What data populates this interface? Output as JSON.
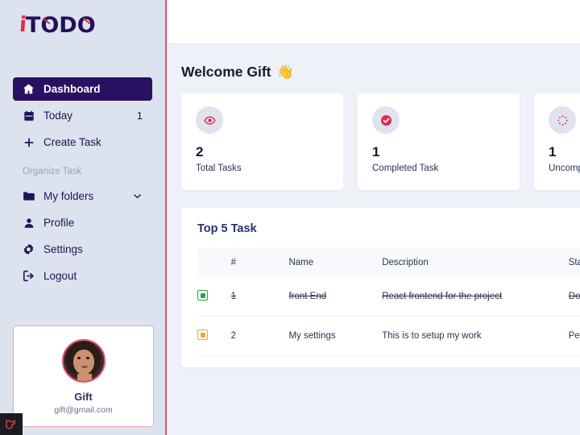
{
  "brand": {
    "logo_prefix": "i",
    "logo_text": "TODO",
    "accent_red": "#e8264a",
    "brand_navy": "#231257",
    "active_nav_bg": "#2a1060"
  },
  "sidebar": {
    "items": [
      {
        "id": "dashboard",
        "label": "Dashboard",
        "icon": "home-icon",
        "active": true,
        "badge": ""
      },
      {
        "id": "today",
        "label": "Today",
        "icon": "calendar-icon",
        "active": false,
        "badge": "1"
      },
      {
        "id": "create-task",
        "label": "Create Task",
        "icon": "plus-icon",
        "active": false,
        "badge": ""
      }
    ],
    "section_label": "Organize Task",
    "items2": [
      {
        "id": "my-folders",
        "label": "My folders",
        "icon": "folder-icon",
        "chevron": "chevron-down-icon"
      },
      {
        "id": "profile",
        "label": "Profile",
        "icon": "user-icon",
        "chevron": ""
      },
      {
        "id": "settings",
        "label": "Settings",
        "icon": "gear-icon",
        "chevron": ""
      },
      {
        "id": "logout",
        "label": "Logout",
        "icon": "logout-icon",
        "chevron": ""
      }
    ],
    "profile_card": {
      "avatar": "user-photo",
      "name": "Gift",
      "email": "gift@gmail.com"
    }
  },
  "debug_badge": {
    "icon": "laravel-logo-icon"
  },
  "main": {
    "welcome_title": "Welcome Gift",
    "welcome_emoji": "👋",
    "stats": [
      {
        "id": "total",
        "icon": "eye-icon",
        "value": "2",
        "label": "Total Tasks"
      },
      {
        "id": "completed",
        "icon": "check-circle-icon",
        "value": "1",
        "label": "Completed Task"
      },
      {
        "id": "uncompleted",
        "icon": "dotted-circle-icon",
        "value": "1",
        "label": "Uncompleted Task"
      }
    ],
    "panel": {
      "title": "Top 5 Task",
      "columns": [
        "#",
        "Name",
        "Description",
        "Status"
      ],
      "rows": [
        {
          "checkbox_color": "green",
          "index": "1",
          "name": "front End",
          "description": "React frontend for the project",
          "status": "Done",
          "struck": true
        },
        {
          "checkbox_color": "orange",
          "index": "2",
          "name": "My settings",
          "description": "This is to setup my work",
          "status": "Pending",
          "struck": false
        }
      ]
    }
  }
}
